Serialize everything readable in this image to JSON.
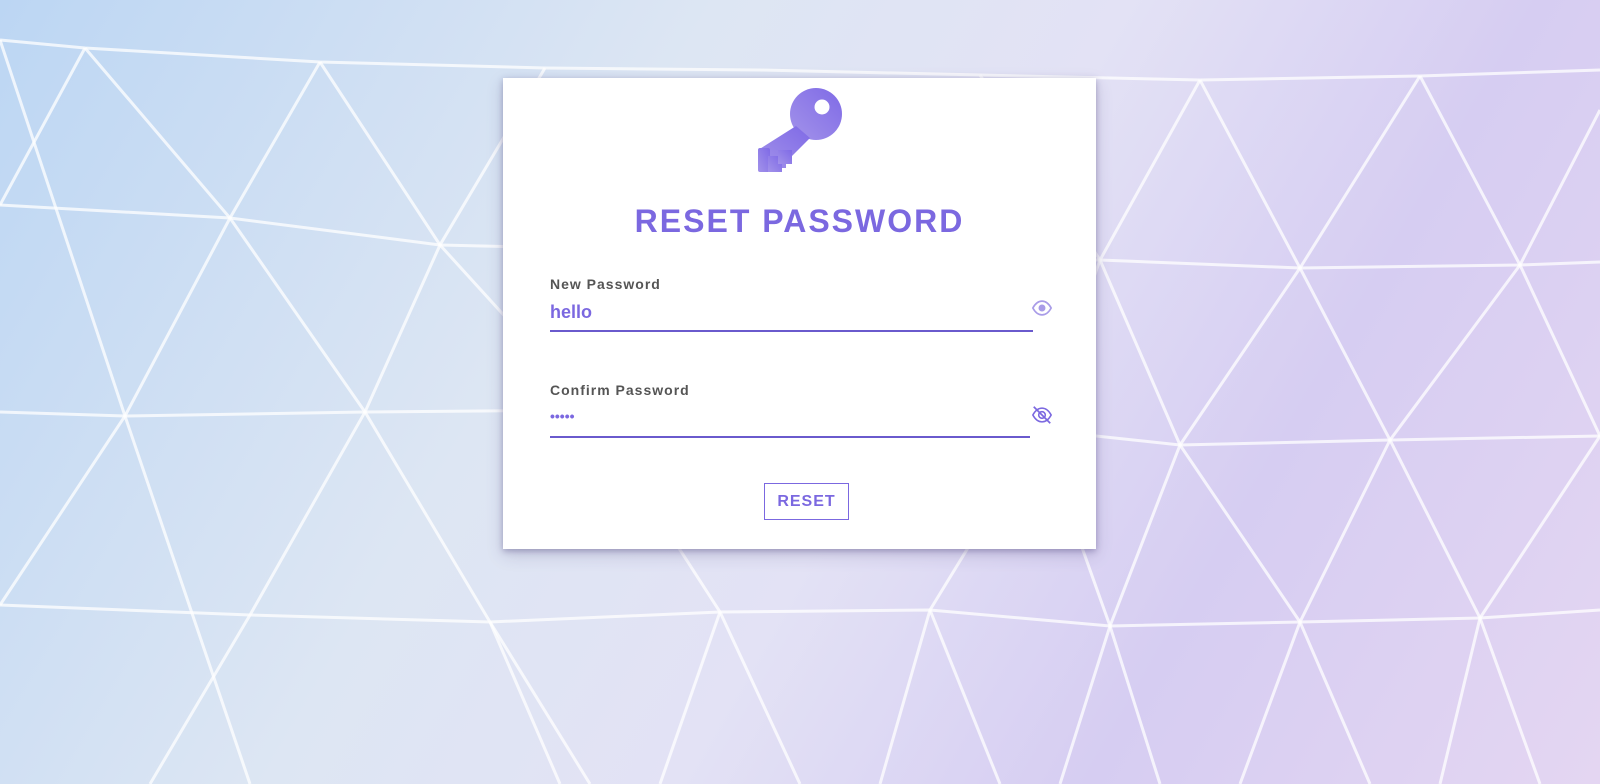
{
  "page": {
    "title": "RESET PASSWORD",
    "icon": "key-icon",
    "accent_color": "#7b68e0"
  },
  "form": {
    "new_password": {
      "label": "New Password",
      "value": "hello",
      "toggle_icon": "eye-icon"
    },
    "confirm_password": {
      "label": "Confirm Password",
      "value": "•••••",
      "toggle_icon": "eye-slash-icon"
    },
    "submit_label": "RESET"
  }
}
